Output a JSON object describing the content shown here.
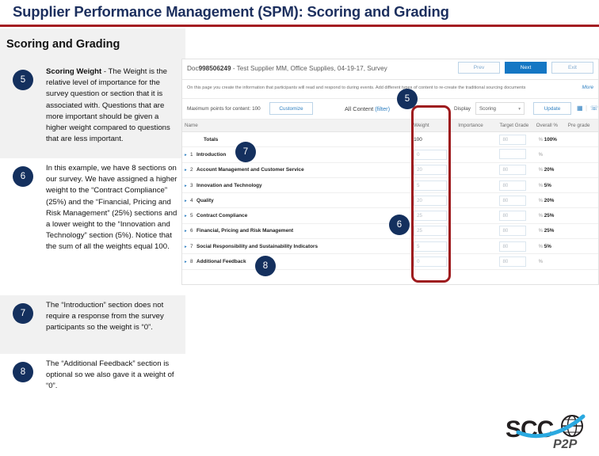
{
  "slide": {
    "title": "Supplier Performance Management (SPM): Scoring and Grading",
    "section_heading": "Scoring and Grading",
    "accent_navy": "#1c2f5e",
    "accent_red": "#a41e22",
    "badge_navy": "#14305e",
    "highlight_red": "#9e1b1e"
  },
  "bullets": [
    {
      "number": "5",
      "lead": "Scoring Weight",
      "text": " - The Weight is the relative level of importance for the survey question or section that it is associated with. Questions that are more important should be given a higher weight compared to questions that are less important."
    },
    {
      "number": "6",
      "lead": "",
      "text": "In this example, we have 8 sections on our survey.  We have assigned a higher weight to the “Contract Compliance” (25%) and the “Financial, Pricing and Risk Management” (25%) sections and a lower weight to the  “Innovation and Technology” section (5%). Notice that the sum of all the weights equal 100."
    },
    {
      "number": "7",
      "lead": "",
      "text": "The “Introduction” section does not require a response from the survey participants so the weight is “0”."
    },
    {
      "number": "8",
      "lead": "",
      "text": "The “Additional Feedback” section is optional so we also gave it a weight of “0”."
    }
  ],
  "app": {
    "doc_title_prefix": "Doc",
    "doc_id": "998506249",
    "doc_title_suffix": " - Test Supplier MM, Office Supplies, 04-19-17, Survey",
    "doc_title_full": "Doc998506249 - Test Supplier MM, Office Supplies, 04-19-17, Survey",
    "nav_buttons": [
      {
        "label": "Prev",
        "style": "secondary"
      },
      {
        "label": "Next",
        "style": "primary"
      },
      {
        "label": "Exit",
        "style": "secondary"
      }
    ],
    "instruction": "On this page you create the information that participants will read and respond to during events.  Add different types of content to re-create the traditional sourcing documents",
    "instruction_more": "More",
    "toolbar": {
      "max_points_label": "Maximum points for content:",
      "max_points_value": "100",
      "customize_label": "Customize",
      "all_content_label": "All Content",
      "filter_label": "(filter)",
      "display_label": "Display",
      "display_value": "Scoring",
      "update_label": "Update",
      "grid_icon": "grid-view-icon",
      "people_icon": "participants-icon",
      "chevron_icon": "chevron-down-icon"
    },
    "table": {
      "columns": [
        "Name",
        "Weight",
        "Importance",
        "Target Grade",
        "Overall %",
        "Pre grade"
      ],
      "totals": {
        "name": "Totals",
        "weight": "100",
        "importance": "",
        "target_grade": "80",
        "overall_pct": "100%",
        "pre_grade": ""
      },
      "rows": [
        {
          "num": "1",
          "name": "Introduction",
          "weight": "0",
          "importance": "",
          "target_grade": "",
          "overall_pct": "",
          "pre_grade": ""
        },
        {
          "num": "2",
          "name": "Account Management and Customer Service",
          "weight": "20",
          "importance": "",
          "target_grade": "80",
          "overall_pct": "20%",
          "pre_grade": ""
        },
        {
          "num": "3",
          "name": "Innovation and Technology",
          "weight": "5",
          "importance": "",
          "target_grade": "80",
          "overall_pct": "5%",
          "pre_grade": ""
        },
        {
          "num": "4",
          "name": "Quality",
          "weight": "20",
          "importance": "",
          "target_grade": "80",
          "overall_pct": "20%",
          "pre_grade": ""
        },
        {
          "num": "5",
          "name": "Contract Compliance",
          "weight": "25",
          "importance": "",
          "target_grade": "80",
          "overall_pct": "25%",
          "pre_grade": ""
        },
        {
          "num": "6",
          "name": "Financial, Pricing and Risk Management",
          "weight": "25",
          "importance": "",
          "target_grade": "80",
          "overall_pct": "25%",
          "pre_grade": ""
        },
        {
          "num": "7",
          "name": "Social Responsibility and Sustainability Indicators",
          "weight": "5",
          "importance": "",
          "target_grade": "80",
          "overall_pct": "5%",
          "pre_grade": ""
        },
        {
          "num": "8",
          "name": "Additional Feedback",
          "weight": "0",
          "importance": "",
          "target_grade": "80",
          "overall_pct": "",
          "pre_grade": ""
        }
      ]
    }
  },
  "callouts": [
    {
      "number": "5",
      "target": "weight-column-header"
    },
    {
      "number": "6",
      "target": "weight-column-values"
    },
    {
      "number": "7",
      "target": "introduction-row"
    },
    {
      "number": "8",
      "target": "additional-feedback-row"
    }
  ],
  "logo": {
    "text": "SCC",
    "subtext": "P2P",
    "icon": "globe-icon"
  }
}
